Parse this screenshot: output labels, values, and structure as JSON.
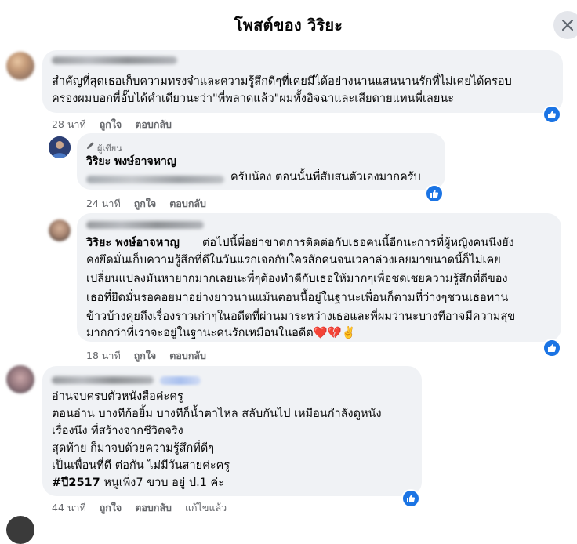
{
  "header": {
    "title": "โพสต์ของ วิริยะ"
  },
  "comments": [
    {
      "lines": [
        "สำคัญที่สุดเธอเก็บความทรงจำและความรู้สึกดีๆที่เคยมีได้อย่างนานแสนนานรักที่ไม่เคยได้ครอบ",
        "ครองผมบอกพี่อั๊บได้คำเดียวนะว่า\"พี่พลาดแล้ว\"ผมทั้งอิจฉาและเสียดายแทนพี่เลยนะ"
      ],
      "time": "28 นาที",
      "like": "ถูกใจ",
      "reply": "ตอบกลับ"
    },
    {
      "author_tag": "ผู้เขียน",
      "author_name": "วิริยะ พงษ์อาจหาญ",
      "text": "ครับน้อง ตอนนั้นพี่สับสนตัวเองมากครับ",
      "time": "24 นาที",
      "like": "ถูกใจ",
      "reply": "ตอบกลับ"
    },
    {
      "mention": "วิริยะ พงษ์อาจหาญ",
      "first_line": "ต่อไปนี้พี่อย่าขาดการติดต่อกับเธอคนนี้อีกนะการที่ผู้หญิงคนนึงยัง",
      "lines": [
        "คงยึดมั่นเก็บความรู้สึกที่ดีในวันแรกเจอกับใครสักคนจนเวลาล่วงเลยมาขนาดนี้ก็ไม่เคย",
        "เปลี่ยนแปลงมันหายากมากเลยนะพี่ๆต้องทำดีกับเธอให้มากๆเพื่อชดเชยความรู้สึกที่ดีของ",
        "เธอที่ยึดมั่นรอคอยมาอย่างยาวนานแม้นตอนนี้อยู่ในฐานะเพื่อนก็ตามที่ว่างๆชวนเธอทาน",
        "ข้าวบ้างคุยถึงเรื่องราวเก่าๆในอดีตที่ผ่านมาระหว่างเธอและพี่ผมว่านะบางทีอาจมีความสุข",
        "มากกว่าที่เราจะอยู่ในฐานะคนรักเหมือนในอดีต❤️💔✌️"
      ],
      "time": "18 นาที",
      "like": "ถูกใจ",
      "reply": "ตอบกลับ"
    },
    {
      "lines": [
        "อ่านจบครบตัวหนังสือค่ะครู",
        "ตอนอ่าน บางทีก้อยิ้ม บางทีก็น้ำตาไหล สลับกันไป เหมือนกำลังดูหนัง",
        "เรื่องนึง ที่สร้างจากชีวิตจริง",
        "สุดท้าย ก็มาจบด้วยความรู้สึกที่ดีๆ",
        "เป็นเพื่อนที่ดี ต่อกัน ไม่มีวันสายค่ะครู"
      ],
      "hashtag": "#ปี2517",
      "last_line_rest": " หนูเพิ่ง7 ขวบ อยู่ ป.1 ค่ะ",
      "time": "44 นาที",
      "like": "ถูกใจ",
      "reply": "ตอบกลับ",
      "edited": "แก้ไขแล้ว"
    }
  ]
}
